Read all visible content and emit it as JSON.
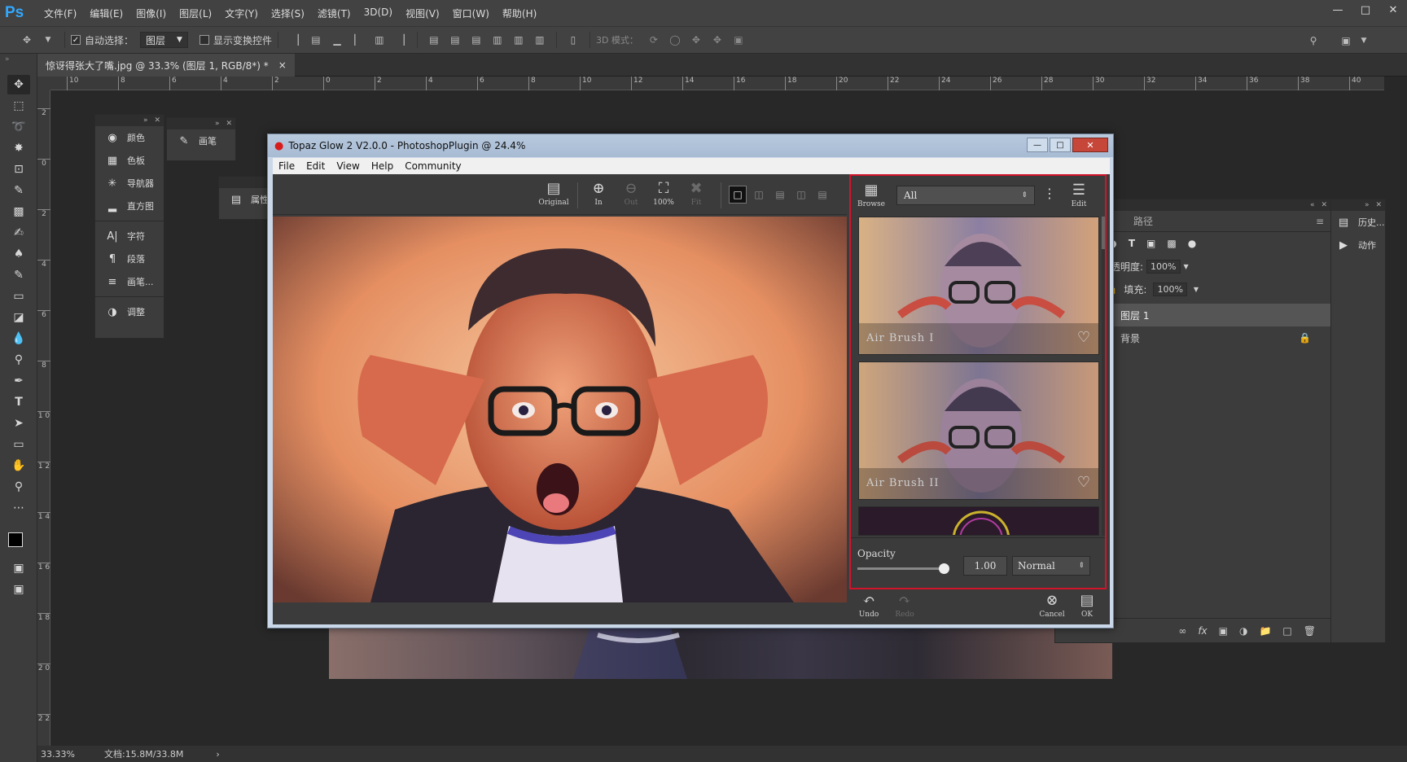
{
  "app": {
    "logo": "Ps",
    "menu": [
      "文件(F)",
      "编辑(E)",
      "图像(I)",
      "图层(L)",
      "文字(Y)",
      "选择(S)",
      "滤镜(T)",
      "3D(D)",
      "视图(V)",
      "窗口(W)",
      "帮助(H)"
    ]
  },
  "options": {
    "auto_select_label": "自动选择：",
    "auto_select_value": "图层",
    "show_transform_label": "显示变换控件",
    "mode3d_label": "3D 模式："
  },
  "document": {
    "tab_title": "惊讶得张大了嘴.jpg @ 33.3% (图层 1, RGB/8*) *",
    "close": "×"
  },
  "ruler": {
    "h_ticks": [
      "10",
      "8",
      "6",
      "4",
      "2",
      "0",
      "2",
      "4",
      "6",
      "8",
      "10",
      "12",
      "14",
      "16",
      "18",
      "20",
      "22",
      "24",
      "26",
      "28",
      "30",
      "32",
      "34",
      "36",
      "38",
      "40"
    ],
    "v_ticks": [
      "2",
      "0",
      "2",
      "4",
      "6",
      "8",
      "1 0",
      "1 2",
      "1 4",
      "1 6",
      "1 8",
      "2 0",
      "2 2"
    ]
  },
  "panels": {
    "left_group": [
      "颜色",
      "色板",
      "导航器",
      "直方图",
      "字符",
      "段落",
      "画笔...",
      "调整"
    ],
    "brush": "画笔",
    "properties": "属性",
    "layers_tab": "路径",
    "opacity_label": "不透明度:",
    "opacity_value": "100%",
    "fill_label": "填充:",
    "fill_value": "100%",
    "layer1": "图层 1",
    "background": "背景",
    "history": "历史...",
    "actions": "动作"
  },
  "status": {
    "zoom": "33.33%",
    "doc": "文档:15.8M/33.8M"
  },
  "topaz": {
    "title": "Topaz Glow 2 V2.0.0 - PhotoshopPlugin @ 24.4%",
    "menu": [
      "File",
      "Edit",
      "View",
      "Help",
      "Community"
    ],
    "tools": [
      "Original",
      "In",
      "Out",
      "100%",
      "Fit"
    ],
    "browse": "Browse",
    "filter": "All",
    "edit": "Edit",
    "presets": [
      "Air Brush I",
      "Air Brush II"
    ],
    "opacity_label": "Opacity",
    "opacity_value": "1.00",
    "blend_mode": "Normal",
    "undo": "Undo",
    "redo": "Redo",
    "cancel": "Cancel",
    "ok": "OK"
  }
}
